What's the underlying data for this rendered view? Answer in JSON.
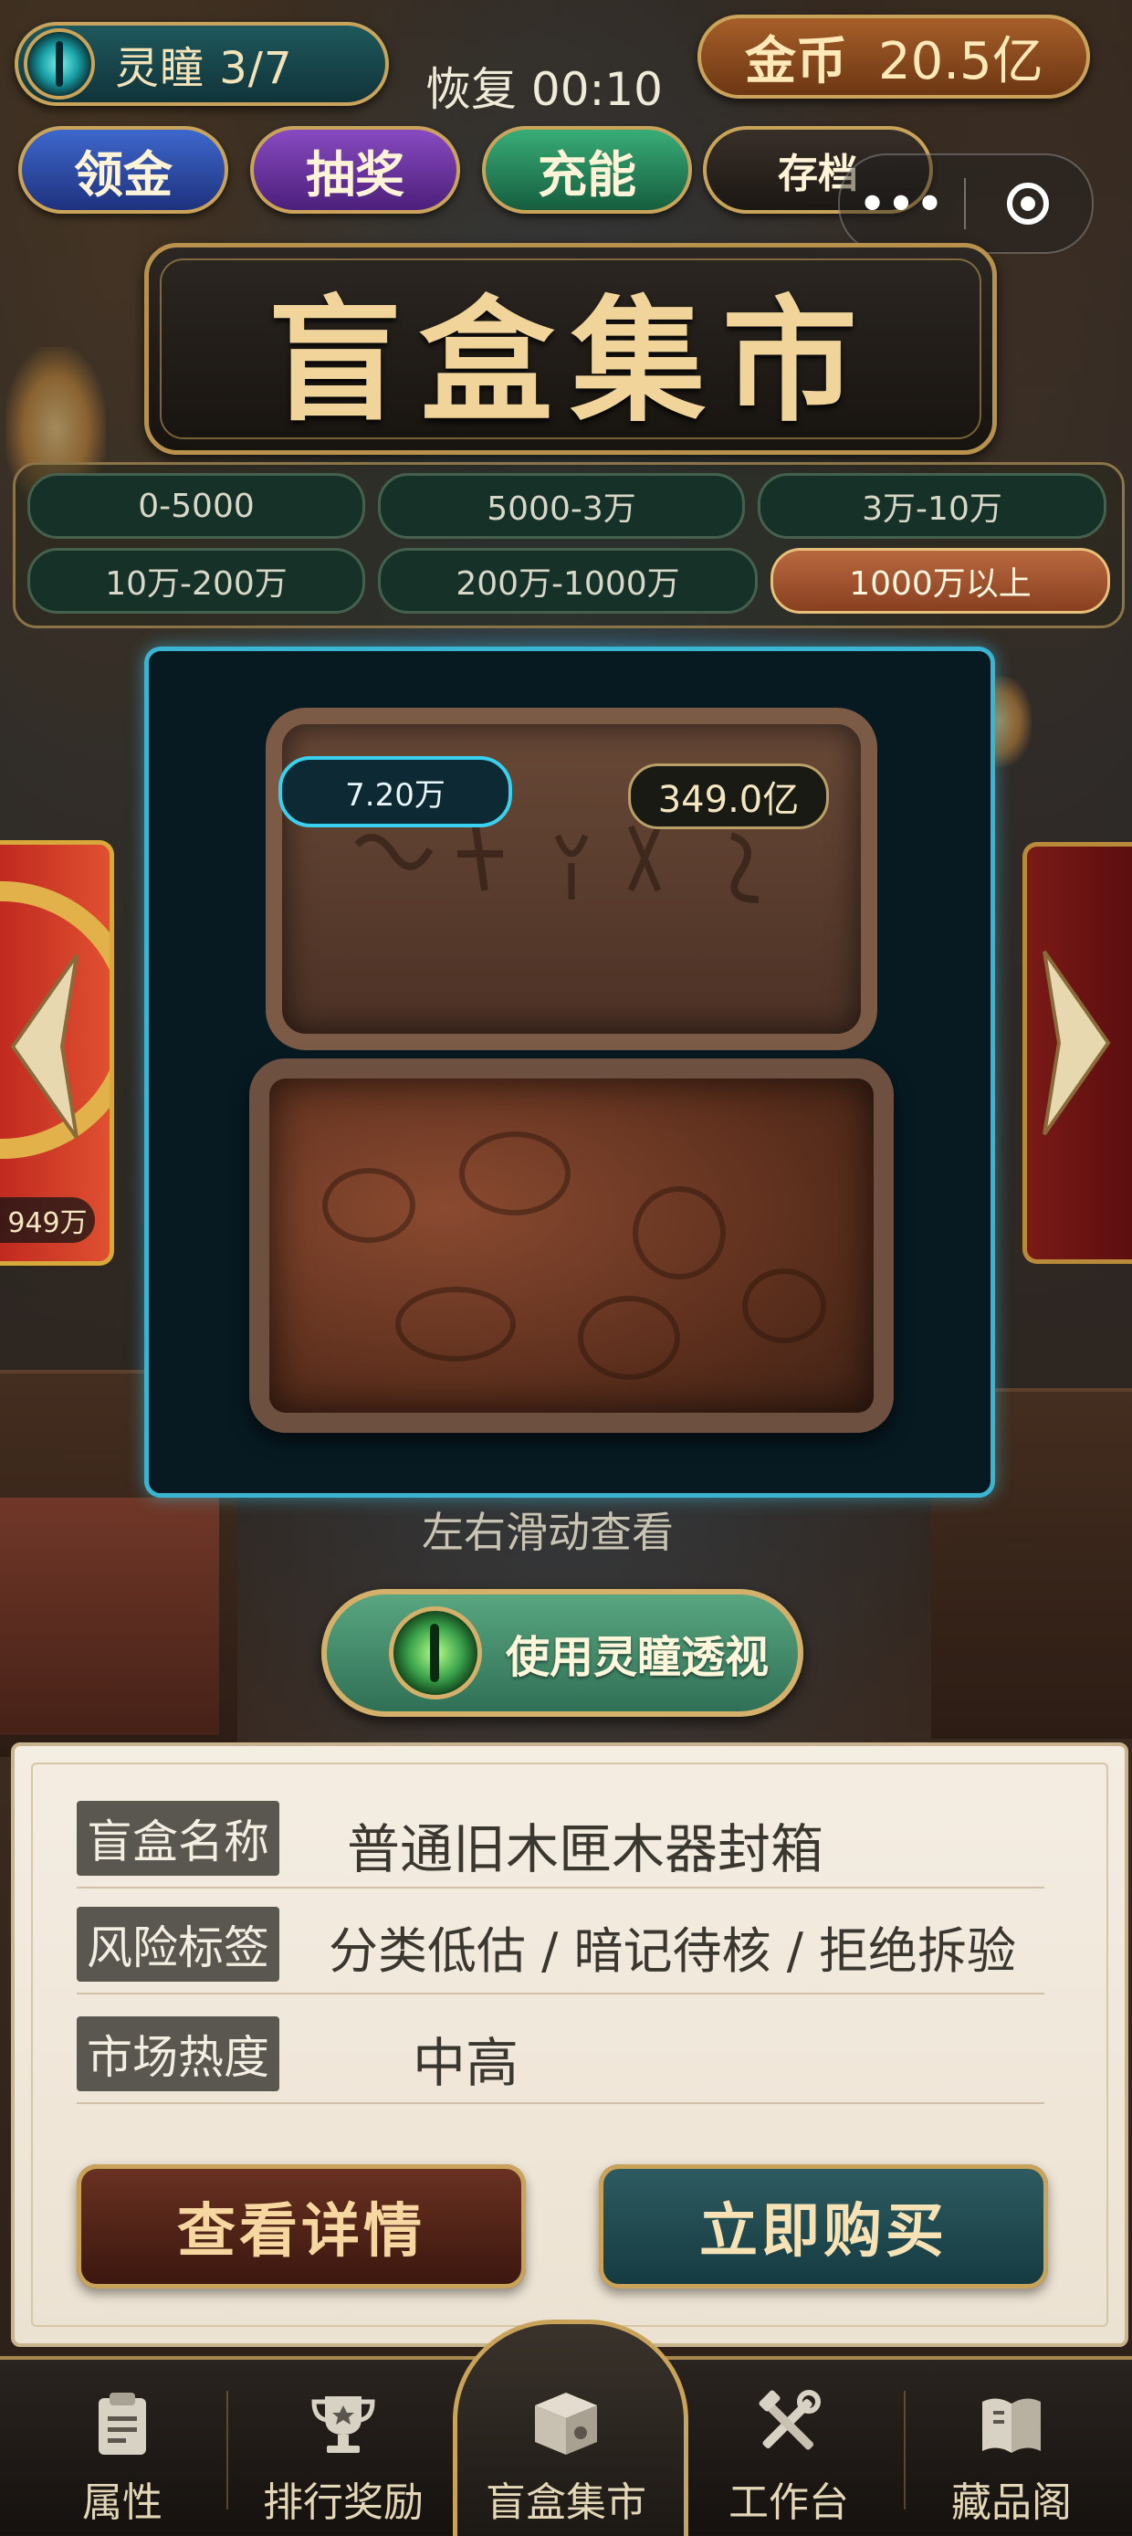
{
  "header": {
    "spirit_eye": "灵瞳 3/7",
    "recover": "恢复 00:10",
    "coin_label": "金币",
    "coin_value": "20.5亿",
    "actions": [
      "领金",
      "抽奖",
      "充能",
      "存档"
    ],
    "capsule_more": "•••"
  },
  "title": "盲盒集市",
  "price_filters": [
    "0-5000",
    "5000-3万",
    "3万-10万",
    "10万-200万",
    "200万-1000万",
    "1000万以上"
  ],
  "active_filter": "1000万以上",
  "carousel": {
    "left_card_price": "949万",
    "current_price": "7.20万",
    "total_value": "349.0亿",
    "swipe_hint": "左右滑动查看"
  },
  "use_eye_button": "使用灵瞳透视",
  "info": {
    "name_label": "盲盒名称",
    "name_value": "普通旧木匣木器封箱",
    "risk_label": "风险标签",
    "risk_value": "分类低估 / 暗记待核 / 拒绝拆验",
    "heat_label": "市场热度",
    "heat_value": "中高"
  },
  "buttons": {
    "detail": "查看详情",
    "buy": "立即购买"
  },
  "nav": [
    "属性",
    "排行奖励",
    "盲盒集市",
    "工作台",
    "藏品阁"
  ],
  "nav_active": "盲盒集市",
  "colors": {
    "accent_gold": "#c9a35a",
    "card_border": "#3ab4d0",
    "active_filter": "#b9683e"
  }
}
